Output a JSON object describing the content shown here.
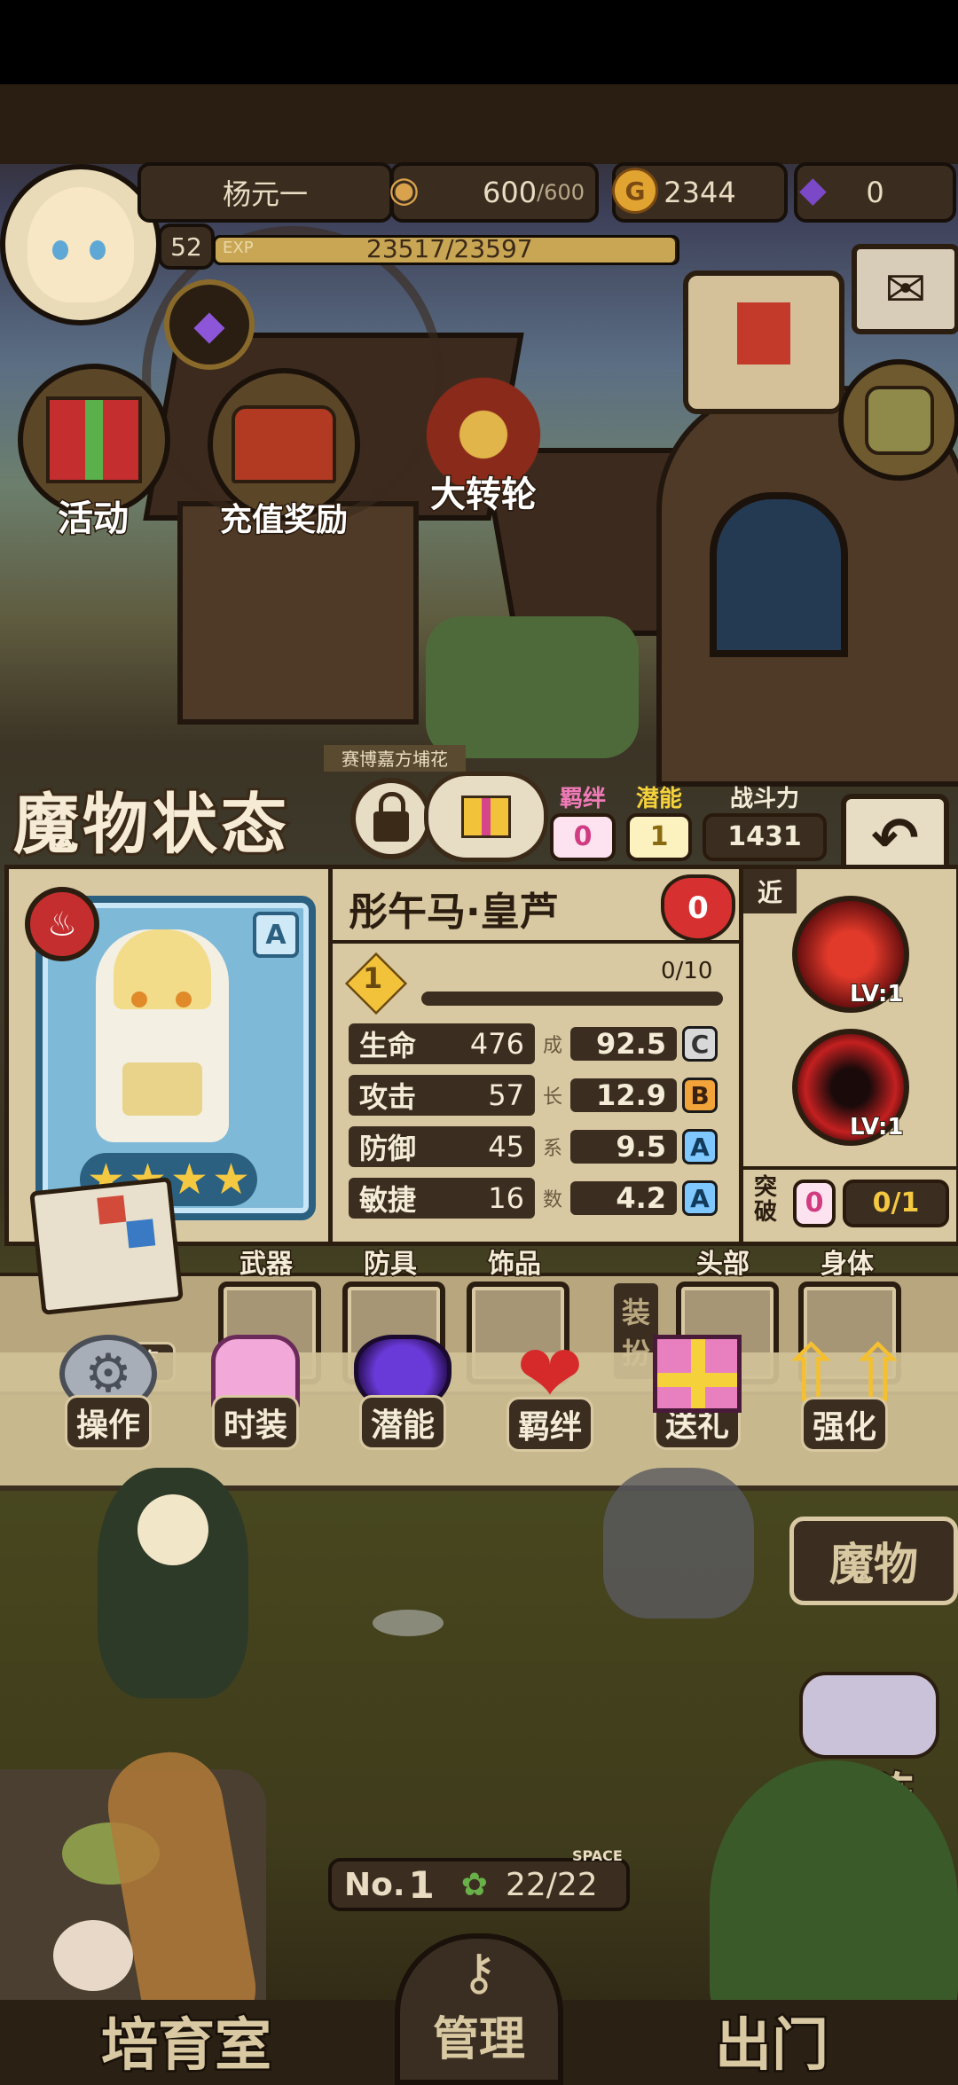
{
  "player": {
    "name": "杨元一",
    "level": "52",
    "exp_label": "EXP",
    "exp_text": "23517/23597",
    "exp_fraction": 0.9966
  },
  "resources": {
    "stamina": "600",
    "stamina_max": "/600",
    "gold": "2344",
    "gem": "0"
  },
  "town": {
    "activity_label": "活动",
    "recharge_label": "充值奖励",
    "wheel_label": "大转轮",
    "sign_text": "赛博嘉方埔花"
  },
  "status": {
    "title": "魔物状态",
    "bond_label": "羁绊",
    "bond_value": "0",
    "potential_label": "潜能",
    "potential_value": "1",
    "power_label": "战斗力",
    "power_value": "1431"
  },
  "monster": {
    "name": "彤午马·皇芦",
    "hearts": "0",
    "rank": "A",
    "stars": 4,
    "level_badge": "1",
    "progress_text": "0/10",
    "progress_fraction": 0,
    "growth_chars": [
      "成",
      "长",
      "系",
      "数"
    ],
    "stats": [
      {
        "name": "生命",
        "value": "476",
        "growth": "92.5",
        "grade": "C"
      },
      {
        "name": "攻击",
        "value": "57",
        "growth": "12.9",
        "grade": "B"
      },
      {
        "name": "防御",
        "value": "45",
        "growth": "9.5",
        "grade": "A"
      },
      {
        "name": "敏捷",
        "value": "16",
        "growth": "4.2",
        "grade": "A"
      }
    ]
  },
  "skills": {
    "range_label": "近",
    "skill1_level": "LV:1",
    "skill2_level": "LV:1",
    "breakthrough_label_1": "突",
    "breakthrough_label_2": "破",
    "breakthrough_value": "0",
    "breakthrough_progress": "0/1"
  },
  "equipment": {
    "codex_label": "图鉴",
    "weapon": "武器",
    "armor": "防具",
    "accessory": "饰品",
    "dressup_1": "装",
    "dressup_2": "扮",
    "head": "头部",
    "body": "身体"
  },
  "actions": [
    {
      "label": "操作",
      "icon": "gear-icon"
    },
    {
      "label": "时装",
      "icon": "dress-icon"
    },
    {
      "label": "潜能",
      "icon": "demon-icon"
    },
    {
      "label": "羁绊",
      "icon": "hearts-icon"
    },
    {
      "label": "送礼",
      "icon": "gift-icon"
    },
    {
      "label": "强化",
      "icon": "upgrade-arrows-icon"
    }
  ],
  "side_buttons": {
    "monster": "魔物",
    "formation": "战阵"
  },
  "farm": {
    "number_label": "No.",
    "number": "1",
    "space_label": "SPACE",
    "space_value": "22/22"
  },
  "bottom_nav": {
    "nursery": "培育室",
    "manage": "管理",
    "go_out": "出门"
  },
  "colors": {
    "grade_C": "#d8d8d8",
    "grade_B": "#f2a33a",
    "grade_A": "#7fc8ff",
    "bond_pink": "#f07ab8",
    "potential_yellow": "#f5d23c"
  }
}
